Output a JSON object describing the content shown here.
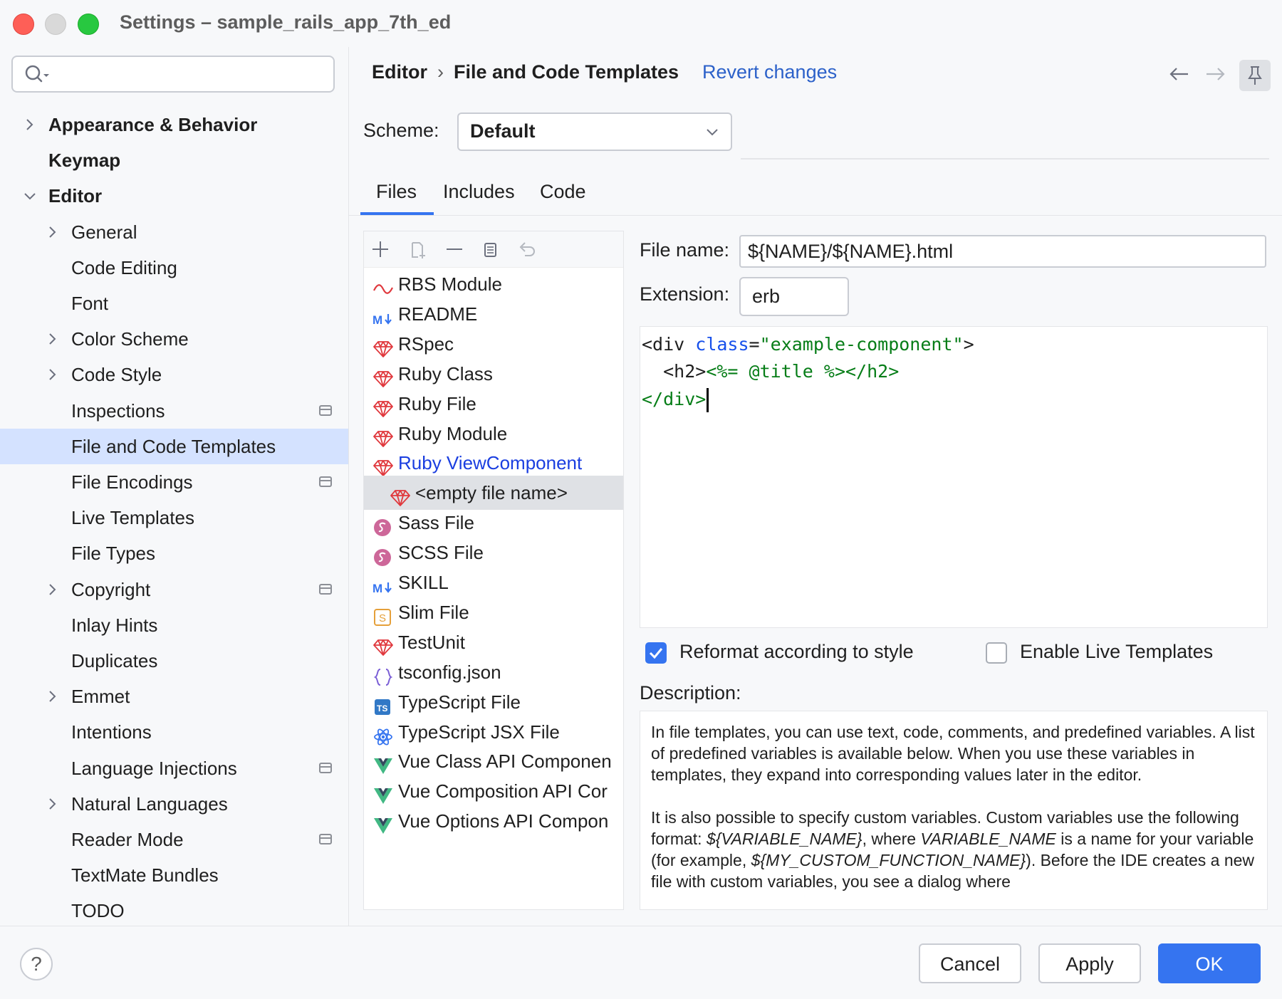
{
  "window": {
    "title": "Settings – sample_rails_app_7th_ed"
  },
  "search": {
    "value": ""
  },
  "tree": [
    {
      "label": "Appearance & Behavior",
      "level": 0,
      "chevron": "right",
      "name": "tree-item-appearance-behavior"
    },
    {
      "label": "Keymap",
      "level": 0,
      "chevron": "",
      "name": "tree-item-keymap"
    },
    {
      "label": "Editor",
      "level": 0,
      "chevron": "down",
      "name": "tree-item-editor"
    },
    {
      "label": "General",
      "level": 1,
      "chevron": "right",
      "name": "tree-item-general"
    },
    {
      "label": "Code Editing",
      "level": 1,
      "chevron": "",
      "name": "tree-item-code-editing"
    },
    {
      "label": "Font",
      "level": 1,
      "chevron": "",
      "name": "tree-item-font"
    },
    {
      "label": "Color Scheme",
      "level": 1,
      "chevron": "right",
      "name": "tree-item-color-scheme"
    },
    {
      "label": "Code Style",
      "level": 1,
      "chevron": "right",
      "name": "tree-item-code-style"
    },
    {
      "label": "Inspections",
      "level": 1,
      "chevron": "",
      "project": true,
      "name": "tree-item-inspections"
    },
    {
      "label": "File and Code Templates",
      "level": 1,
      "chevron": "",
      "selected": true,
      "name": "tree-item-file-and-code-templates"
    },
    {
      "label": "File Encodings",
      "level": 1,
      "chevron": "",
      "project": true,
      "name": "tree-item-file-encodings"
    },
    {
      "label": "Live Templates",
      "level": 1,
      "chevron": "",
      "name": "tree-item-live-templates"
    },
    {
      "label": "File Types",
      "level": 1,
      "chevron": "",
      "name": "tree-item-file-types"
    },
    {
      "label": "Copyright",
      "level": 1,
      "chevron": "right",
      "project": true,
      "name": "tree-item-copyright"
    },
    {
      "label": "Inlay Hints",
      "level": 1,
      "chevron": "",
      "name": "tree-item-inlay-hints"
    },
    {
      "label": "Duplicates",
      "level": 1,
      "chevron": "",
      "name": "tree-item-duplicates"
    },
    {
      "label": "Emmet",
      "level": 1,
      "chevron": "right",
      "name": "tree-item-emmet"
    },
    {
      "label": "Intentions",
      "level": 1,
      "chevron": "",
      "name": "tree-item-intentions"
    },
    {
      "label": "Language Injections",
      "level": 1,
      "chevron": "",
      "project": true,
      "name": "tree-item-language-injections"
    },
    {
      "label": "Natural Languages",
      "level": 1,
      "chevron": "right",
      "name": "tree-item-natural-languages"
    },
    {
      "label": "Reader Mode",
      "level": 1,
      "chevron": "",
      "project": true,
      "name": "tree-item-reader-mode"
    },
    {
      "label": "TextMate Bundles",
      "level": 1,
      "chevron": "",
      "name": "tree-item-textmate-bundles"
    },
    {
      "label": "TODO",
      "level": 1,
      "chevron": "",
      "name": "tree-item-todo"
    }
  ],
  "header": {
    "breadcrumb_root": "Editor",
    "breadcrumb_sep": "›",
    "breadcrumb_current": "File and Code Templates",
    "revert_label": "Revert changes"
  },
  "scheme": {
    "label": "Scheme:",
    "value": "Default"
  },
  "tabs": [
    {
      "label": "Files",
      "active": true
    },
    {
      "label": "Includes",
      "active": false
    },
    {
      "label": "Code",
      "active": false
    }
  ],
  "file_list": [
    {
      "label": "RBS Module",
      "icon": "rbs-wave-icon",
      "indent": 0
    },
    {
      "label": "README",
      "icon": "markdown-icon",
      "indent": 0
    },
    {
      "label": "RSpec",
      "icon": "ruby-gem-icon",
      "indent": 0
    },
    {
      "label": "Ruby Class",
      "icon": "ruby-gem-icon",
      "indent": 0
    },
    {
      "label": "Ruby File",
      "icon": "ruby-gem-icon",
      "indent": 0
    },
    {
      "label": "Ruby Module",
      "icon": "ruby-gem-icon",
      "indent": 0
    },
    {
      "label": "Ruby ViewComponent",
      "icon": "ruby-gem-icon",
      "indent": 0,
      "highlighted": true
    },
    {
      "label": "<empty file name>",
      "icon": "ruby-gem-icon",
      "indent": 1,
      "selected": true
    },
    {
      "label": "Sass File",
      "icon": "sass-icon",
      "indent": 0
    },
    {
      "label": "SCSS File",
      "icon": "sass-icon",
      "indent": 0
    },
    {
      "label": "SKILL",
      "icon": "markdown-icon",
      "indent": 0
    },
    {
      "label": "Slim File",
      "icon": "slim-icon",
      "indent": 0
    },
    {
      "label": "TestUnit",
      "icon": "ruby-gem-icon",
      "indent": 0
    },
    {
      "label": "tsconfig.json",
      "icon": "json-braces-icon",
      "indent": 0
    },
    {
      "label": "TypeScript File",
      "icon": "typescript-icon",
      "indent": 0
    },
    {
      "label": "TypeScript JSX File",
      "icon": "react-atom-icon",
      "indent": 0
    },
    {
      "label": "Vue Class API Componen",
      "icon": "vue-icon",
      "indent": 0
    },
    {
      "label": "Vue Composition API Cor",
      "icon": "vue-icon",
      "indent": 0
    },
    {
      "label": "Vue Options API Compon",
      "icon": "vue-icon",
      "indent": 0
    }
  ],
  "form": {
    "file_name_label": "File name:",
    "file_name_value": "${NAME}/${NAME}.html",
    "extension_label": "Extension:",
    "extension_value": "erb"
  },
  "code": {
    "line1_open": "<div ",
    "line1_attr": "class",
    "line1_eq": "=",
    "line1_str": "\"example-component\"",
    "line1_close": ">",
    "line2_indent": "  ",
    "line2_open": "<h2>",
    "line2_erb": "<%= @title %>",
    "line2_close": "</h2>",
    "line3": "</div>"
  },
  "options": {
    "reformat_label": "Reformat according to style",
    "reformat_checked": true,
    "live_templates_label": "Enable Live Templates",
    "live_templates_checked": false
  },
  "description": {
    "label": "Description:",
    "p1": "In file templates, you can use text, code, comments, and predefined variables. A list of predefined variables is available below. When you use these variables in templates, they expand into corresponding values later in the editor.",
    "p2_a": "It is also possible to specify custom variables. Custom variables use the following format: ",
    "p2_var1": "${VARIABLE_NAME}",
    "p2_b": ", where ",
    "p2_var2": "VARIABLE_NAME",
    "p2_c": " is a name for your variable (for example, ",
    "p2_var3": "${MY_CUSTOM_FUNCTION_NAME}",
    "p2_d": "). Before the IDE creates a new file with custom variables, you see a dialog where"
  },
  "buttons": {
    "help": "?",
    "cancel": "Cancel",
    "apply": "Apply",
    "ok": "OK"
  },
  "colors": {
    "accent": "#3574f0",
    "selection": "#d4e2ff",
    "link": "#2c61c9",
    "ruby": "#e0393e"
  }
}
